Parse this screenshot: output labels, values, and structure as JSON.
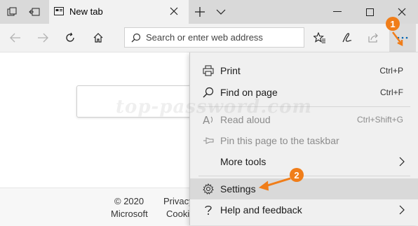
{
  "tab": {
    "title": "New tab"
  },
  "addressbar": {
    "placeholder": "Search or enter web address"
  },
  "footer": {
    "copyright": "© 2020",
    "company": "Microsoft",
    "privacy": "Privacy",
    "cookies": "Cookies"
  },
  "menu": {
    "items": [
      {
        "label": "Print",
        "shortcut": "Ctrl+P",
        "icon": "printer-icon"
      },
      {
        "label": "Find on page",
        "shortcut": "Ctrl+F",
        "icon": "search-icon"
      },
      {
        "label": "Read aloud",
        "shortcut": "Ctrl+Shift+G",
        "icon": "read-aloud-icon",
        "disabled": true
      },
      {
        "label": "Pin this page to the taskbar",
        "icon": "pin-icon",
        "disabled": true
      },
      {
        "label": "More tools",
        "icon": "chevron-right-icon"
      },
      {
        "label": "Settings",
        "icon": "gear-icon",
        "highlighted": true
      },
      {
        "label": "Help and feedback",
        "icon": "help-icon"
      }
    ]
  },
  "watermark": "top-password.com",
  "annotations": {
    "badge1": "1",
    "badge2": "2"
  },
  "colors": {
    "accent": "#f07d19",
    "titlebar": "#d9d9d9",
    "menu_bg": "#f0f0f0"
  }
}
